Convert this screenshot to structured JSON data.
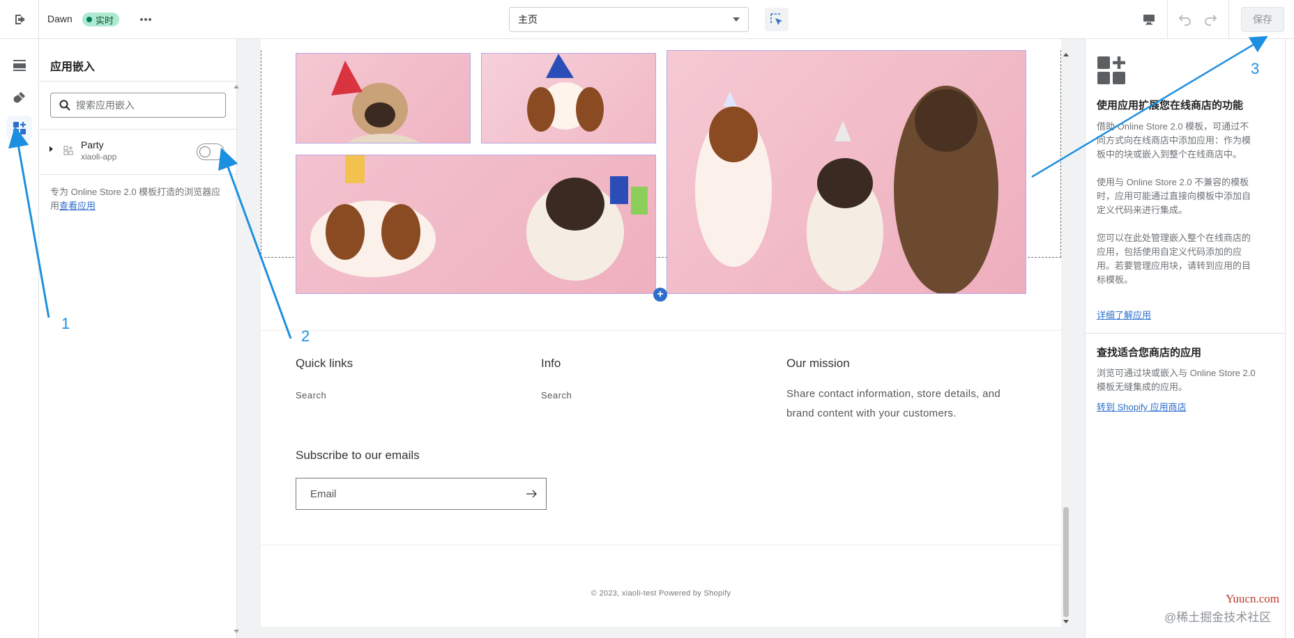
{
  "topbar": {
    "theme_name": "Dawn",
    "live_badge": "实时",
    "page_select": "主页",
    "save_label": "保存"
  },
  "icons": {
    "exit": "exit-icon",
    "more": "more-icon",
    "inspect": "inspect-icon",
    "desktop": "desktop-icon",
    "undo": "undo-icon",
    "redo": "redo-icon"
  },
  "rail": {
    "items": [
      {
        "name": "sections-icon",
        "active": false
      },
      {
        "name": "theme-settings-icon",
        "active": false
      },
      {
        "name": "app-embeds-icon",
        "active": true
      }
    ]
  },
  "left_panel": {
    "title": "应用嵌入",
    "search_placeholder": "搜索应用嵌入",
    "app": {
      "name": "Party",
      "subtitle": "xiaoli-app",
      "enabled": false
    },
    "description": "专为 Online Store 2.0 模板打造的浏览器应用",
    "description_link": "查看应用"
  },
  "preview": {
    "footer": {
      "quick_links_title": "Quick links",
      "quick_links_item": "Search",
      "info_title": "Info",
      "info_item": "Search",
      "mission_title": "Our mission",
      "mission_text": "Share contact information, store details, and brand content with your customers.",
      "subscribe_title": "Subscribe to our emails",
      "email_placeholder": "Email",
      "copyright": "© 2023, xiaoli-test Powered by Shopify"
    }
  },
  "right_panel": {
    "title1": "使用应用扩展您在线商店的功能",
    "para1": "借助 Online Store 2.0 模板，可通过不同方式向在线商店中添加应用：作为模板中的块或嵌入到整个在线商店中。",
    "para2": "使用与 Online Store 2.0 不兼容的模板时，应用可能通过直接向模板中添加自定义代码来进行集成。",
    "para3": "您可以在此处管理嵌入整个在线商店的应用，包括使用自定义代码添加的应用。若要管理应用块，请转到应用的目标模板。",
    "link1": "详细了解应用",
    "title2": "查找适合您商店的应用",
    "para4": "浏览可通过块或嵌入与 Online Store 2.0 模板无缝集成的应用。",
    "link2": "转到 Shopify 应用商店"
  },
  "annotations": {
    "n1": "1",
    "n2": "2",
    "n3": "3",
    "color": "#1d8fe0"
  },
  "watermarks": {
    "site": "Yuucn.com",
    "community": "@稀土掘金技术社区"
  }
}
